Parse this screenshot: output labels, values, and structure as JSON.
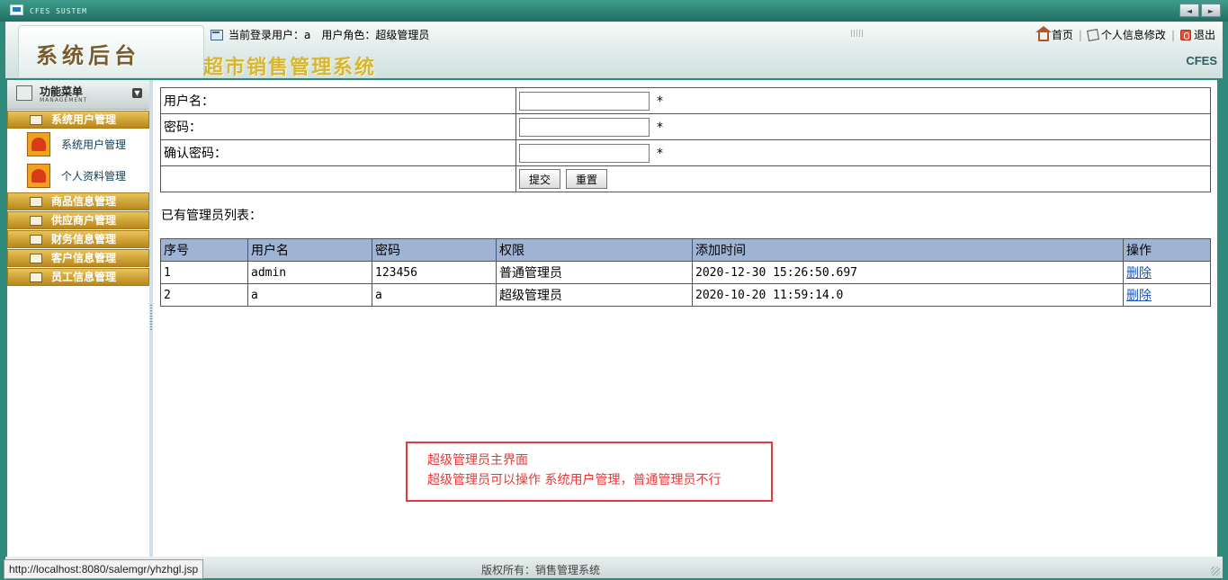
{
  "window": {
    "system_label": "CFES SUSTEM",
    "nav": [
      "◄",
      "►"
    ]
  },
  "header": {
    "logo": "系统后台",
    "system_title": "超市销售管理系统",
    "user_info": "当前登录用户：a　用户角色：超级管理员",
    "links": {
      "home": "首页",
      "profile": "个人信息修改",
      "logout": "退出"
    },
    "brand": "CFES"
  },
  "sidebar": {
    "title": "功能菜单",
    "subtitle": "MANAGEMENT",
    "categories": [
      {
        "label": "系统用户管理",
        "items": [
          "系统用户管理",
          "个人资料管理"
        ]
      },
      {
        "label": "商品信息管理"
      },
      {
        "label": "供应商户管理"
      },
      {
        "label": "财务信息管理"
      },
      {
        "label": "客户信息管理"
      },
      {
        "label": "员工信息管理"
      }
    ]
  },
  "form": {
    "username_label": "用户名：",
    "password_label": "密码：",
    "confirm_label": "确认密码：",
    "required_mark": "*",
    "submit": "提交",
    "reset": "重置"
  },
  "list": {
    "title": "已有管理员列表：",
    "headers": [
      "序号",
      "用户名",
      "密码",
      "权限",
      "添加时间",
      "操作"
    ],
    "rows": [
      [
        "1",
        "admin",
        "123456",
        "普通管理员",
        "2020-12-30 15:26:50.697",
        "删除"
      ],
      [
        "2",
        "a",
        "a",
        "超级管理员",
        "2020-10-20 11:59:14.0",
        "删除"
      ]
    ]
  },
  "annotation": {
    "line1": "超级管理员主界面",
    "line2": "超级管理员可以操作 系统用户管理，普通管理员不行"
  },
  "status": {
    "copyright": "版权所有：销售管理系统",
    "url": "http://localhost:8080/salemgr/yhzhgl.jsp"
  }
}
